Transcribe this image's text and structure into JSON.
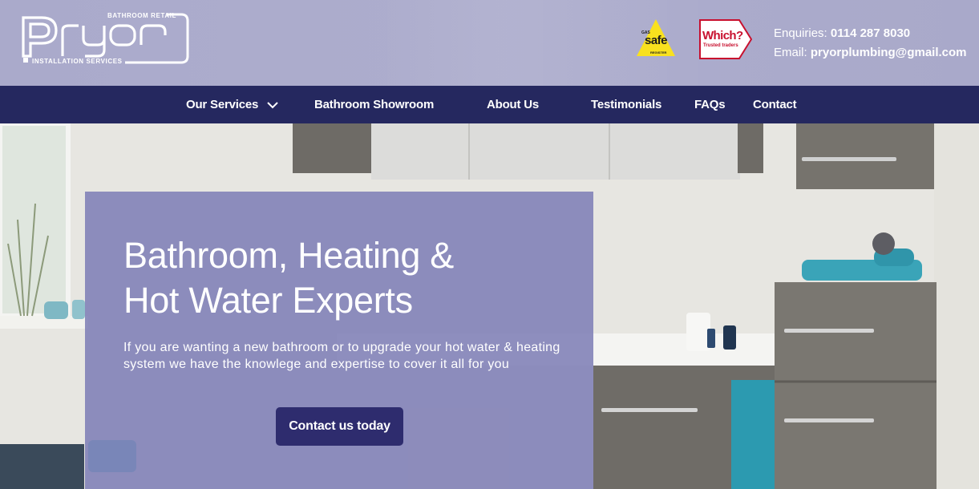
{
  "brand": {
    "logo_word": "Pryor",
    "tag_top": "BATHROOM RETAIL",
    "tag_bottom": "INSTALLATION SERVICES"
  },
  "badges": {
    "gas_safe": {
      "small": "GAS",
      "main": "safe",
      "reg": "REGISTER"
    },
    "which": {
      "title": "Which?",
      "subtitle": "Trusted traders"
    }
  },
  "contact": {
    "enquiries_label": "Enquiries:",
    "phone": "0114 287 8030",
    "email_label": "Email:",
    "email": "pryorplumbing@gmail.com"
  },
  "nav": {
    "items": [
      {
        "label": "Our Services"
      },
      {
        "label": "Bathroom Showroom"
      },
      {
        "label": "About Us"
      },
      {
        "label": "Testimonials"
      },
      {
        "label": "FAQs"
      },
      {
        "label": "Contact"
      }
    ]
  },
  "hero": {
    "title_line1": "Bathroom, Heating &",
    "title_line2": "Hot Water Experts",
    "text": "If you are wanting a new bathroom or to upgrade your hot water & heating system we have the knowlege and expertise to cover it all for you",
    "cta": "Contact us today"
  },
  "colors": {
    "header_bg": "#abaacb",
    "nav_bg": "#25285f",
    "panel_bg": "#8080b6",
    "button_bg": "#2e2c6e",
    "gas_safe_yellow": "#f9e11e",
    "which_red": "#c8102e"
  }
}
